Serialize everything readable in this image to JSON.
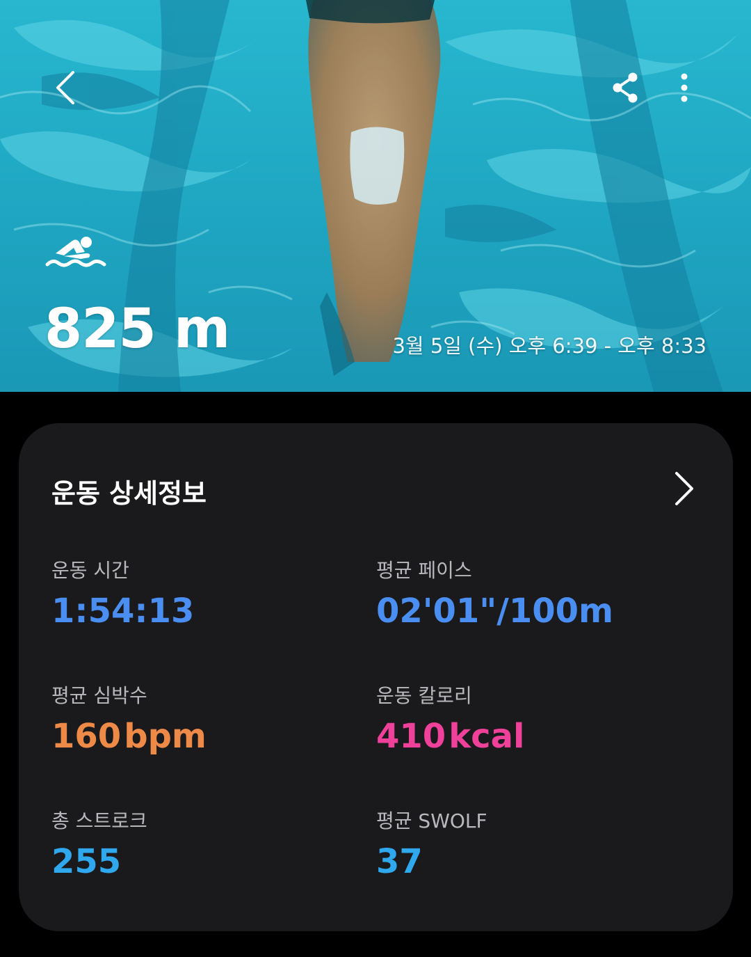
{
  "hero": {
    "distance": "825 m",
    "datetime": "3월 5일 (수) 오후 6:39 - 오후 8:33",
    "icons": {
      "back": "chevron-left-icon",
      "share": "share-icon",
      "more": "more-vertical-icon",
      "activity": "swimming-icon"
    }
  },
  "details": {
    "title": "운동 상세정보",
    "stats": [
      {
        "label": "운동 시간",
        "value": "1:54:13",
        "unit": "",
        "color": "#4a8ef2"
      },
      {
        "label": "평균 페이스",
        "value": "02'01\"/100m",
        "unit": "",
        "color": "#4a8ef2"
      },
      {
        "label": "평균 심박수",
        "value": "160",
        "unit": "bpm",
        "color": "#ee8a47"
      },
      {
        "label": "운동 칼로리",
        "value": "410",
        "unit": "kcal",
        "color": "#f0419a"
      },
      {
        "label": "총 스트로크",
        "value": "255",
        "unit": "",
        "color": "#2fa8ee"
      },
      {
        "label": "평균 SWOLF",
        "value": "37",
        "unit": "",
        "color": "#2fa8ee"
      }
    ]
  },
  "colors": {
    "background": "#000000",
    "card": "#1a1a1c",
    "water": "#1fa9c4",
    "label": "#b9b9bd"
  }
}
